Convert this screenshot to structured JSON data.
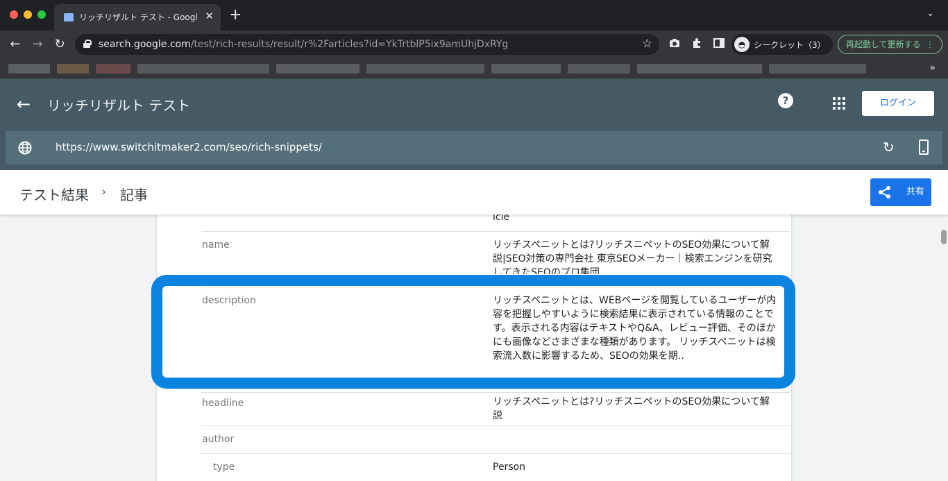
{
  "browser": {
    "tab_title": "リッチリザルト テスト - Google",
    "tab_close": "✕",
    "new_tab": "+",
    "tab_menu": "⌄",
    "url_host": "search.google.com",
    "url_path": "/test/rich-results/result/r%2Farticles?id=YkTrtblP5ix9amUhjDxRYg",
    "profile_label": "シークレット（3）",
    "relaunch_label": "再起動して更新する",
    "relaunch_dots": "⋮",
    "bookmarks_more": "»"
  },
  "app": {
    "title": "リッチリザルト テスト",
    "login_label": "ログイン",
    "help_glyph": "?",
    "back_glyph": "←",
    "tested_url": "https://www.switchitmaker2.com/seo/rich-snippets/"
  },
  "breadcrumb": {
    "root": "テスト結果",
    "separator": "›",
    "current": "記事",
    "share_label": "共有"
  },
  "properties": {
    "clipped_value": "icle",
    "rows": [
      {
        "name": "name",
        "value": "リッチスペニットとは?リッチスニペットのSEO効果について解説|SEO対策の専門会社 東京SEOメーカー｜検索エンジンを研究してきたSEOのプロ集団"
      },
      {
        "name": "description",
        "value": "リッチスペニットとは、WEBページを閲覧しているユーザーが内容を把握しやすいように検索結果に表示されている情報のことです。表示される内容はテキストやQ&A、レビュー評価、そのほかにも画像などさまざまな種類があります。 リッチスペニットは検索流入数に影響するため、SEOの効果を期.."
      },
      {
        "name": "headline",
        "value": "リッチスペニットとは?リッチスニペットのSEO効果について解説"
      },
      {
        "name": "author",
        "value": ""
      },
      {
        "name": "type",
        "value": "Person"
      }
    ]
  },
  "colors": {
    "appbar": "#455a64",
    "urlbar": "#546e7a",
    "highlight": "#0b84e0",
    "accent": "#1a73e8"
  }
}
